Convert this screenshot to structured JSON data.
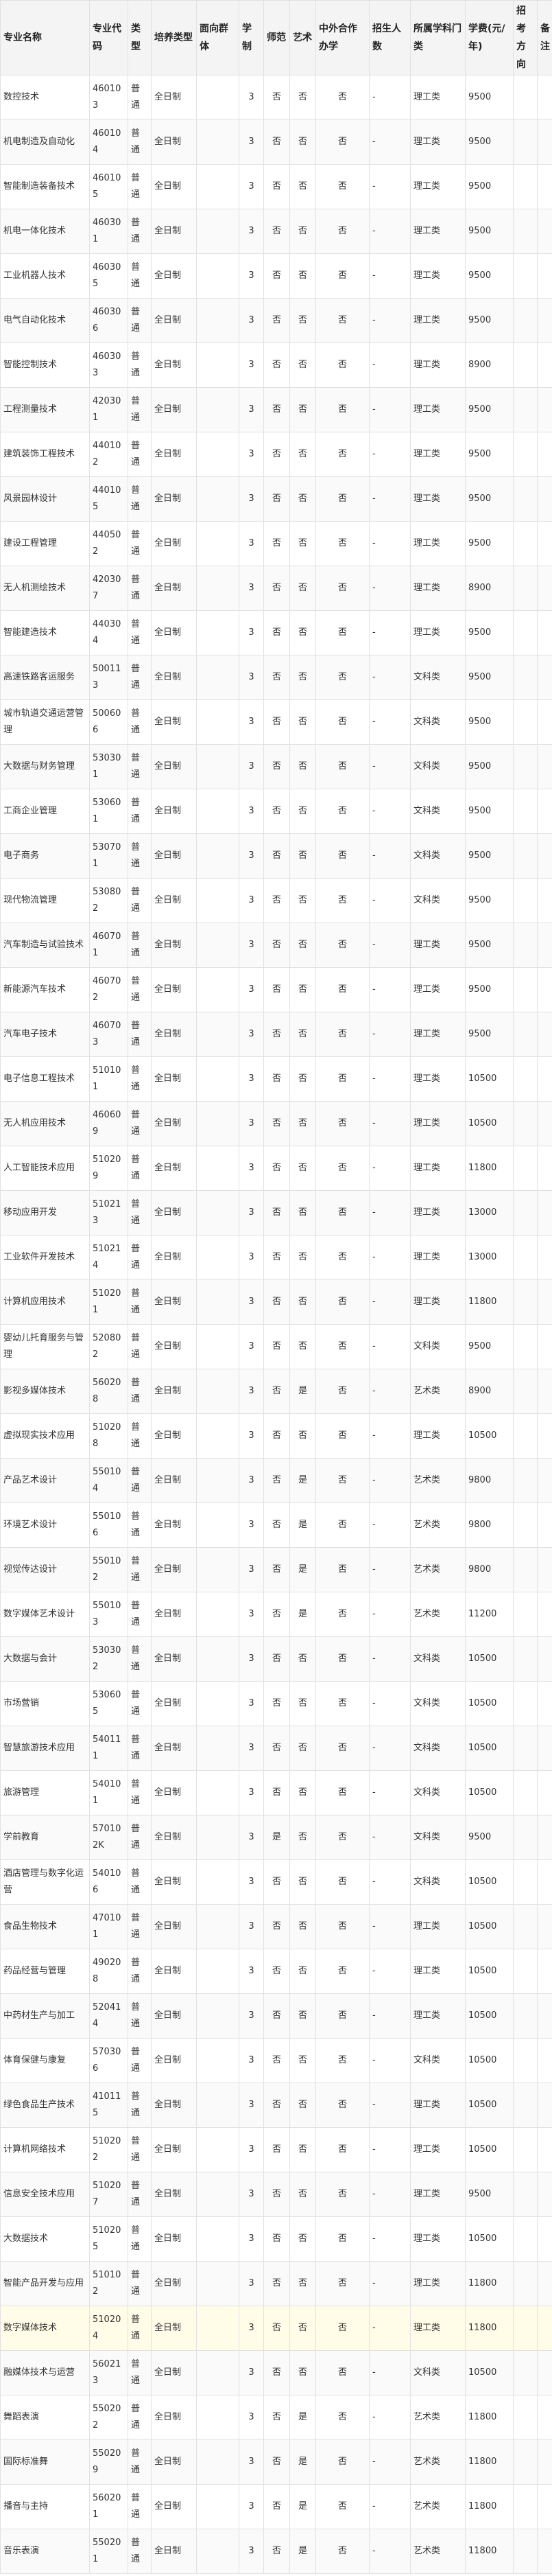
{
  "table": {
    "columns": [
      "专业名称",
      "专业代码",
      "类型",
      "培养类型",
      "面向群体",
      "学制",
      "师范",
      "艺术",
      "中外合作办学",
      "招生人数",
      "所属学科门类",
      "学费(元/年)",
      "招考方向",
      "备注"
    ],
    "rows": [
      [
        "数控技术",
        "460103",
        "普通",
        "全日制",
        "",
        "3",
        "否",
        "否",
        "否",
        "-",
        "理工类",
        "9500",
        "",
        ""
      ],
      [
        "机电制造及自动化",
        "460104",
        "普通",
        "全日制",
        "",
        "3",
        "否",
        "否",
        "否",
        "-",
        "理工类",
        "9500",
        "",
        ""
      ],
      [
        "智能制造装备技术",
        "460105",
        "普通",
        "全日制",
        "",
        "3",
        "否",
        "否",
        "否",
        "-",
        "理工类",
        "9500",
        "",
        ""
      ],
      [
        "机电一体化技术",
        "460301",
        "普通",
        "全日制",
        "",
        "3",
        "否",
        "否",
        "否",
        "-",
        "理工类",
        "9500",
        "",
        ""
      ],
      [
        "工业机器人技术",
        "460305",
        "普通",
        "全日制",
        "",
        "3",
        "否",
        "否",
        "否",
        "-",
        "理工类",
        "9500",
        "",
        ""
      ],
      [
        "电气自动化技术",
        "460306",
        "普通",
        "全日制",
        "",
        "3",
        "否",
        "否",
        "否",
        "-",
        "理工类",
        "9500",
        "",
        ""
      ],
      [
        "智能控制技术",
        "460303",
        "普通",
        "全日制",
        "",
        "3",
        "否",
        "否",
        "否",
        "-",
        "理工类",
        "8900",
        "",
        ""
      ],
      [
        "工程测量技术",
        "420301",
        "普通",
        "全日制",
        "",
        "3",
        "否",
        "否",
        "否",
        "-",
        "理工类",
        "9500",
        "",
        ""
      ],
      [
        "建筑装饰工程技术",
        "440102",
        "普通",
        "全日制",
        "",
        "3",
        "否",
        "否",
        "否",
        "-",
        "理工类",
        "9500",
        "",
        ""
      ],
      [
        "风景园林设计",
        "440105",
        "普通",
        "全日制",
        "",
        "3",
        "否",
        "否",
        "否",
        "-",
        "理工类",
        "9500",
        "",
        ""
      ],
      [
        "建设工程管理",
        "440502",
        "普通",
        "全日制",
        "",
        "3",
        "否",
        "否",
        "否",
        "-",
        "理工类",
        "9500",
        "",
        ""
      ],
      [
        "无人机测绘技术",
        "420307",
        "普通",
        "全日制",
        "",
        "3",
        "否",
        "否",
        "否",
        "-",
        "理工类",
        "8900",
        "",
        ""
      ],
      [
        "智能建造技术",
        "440304",
        "普通",
        "全日制",
        "",
        "3",
        "否",
        "否",
        "否",
        "-",
        "理工类",
        "9500",
        "",
        ""
      ],
      [
        "高速铁路客运服务",
        "500113",
        "普通",
        "全日制",
        "",
        "3",
        "否",
        "否",
        "否",
        "-",
        "文科类",
        "9500",
        "",
        ""
      ],
      [
        "城市轨道交通运营管理",
        "500606",
        "普通",
        "全日制",
        "",
        "3",
        "否",
        "否",
        "否",
        "-",
        "文科类",
        "9500",
        "",
        ""
      ],
      [
        "大数据与财务管理",
        "530301",
        "普通",
        "全日制",
        "",
        "3",
        "否",
        "否",
        "否",
        "-",
        "文科类",
        "9500",
        "",
        ""
      ],
      [
        "工商企业管理",
        "530601",
        "普通",
        "全日制",
        "",
        "3",
        "否",
        "否",
        "否",
        "-",
        "文科类",
        "9500",
        "",
        ""
      ],
      [
        "电子商务",
        "530701",
        "普通",
        "全日制",
        "",
        "3",
        "否",
        "否",
        "否",
        "-",
        "文科类",
        "9500",
        "",
        ""
      ],
      [
        "现代物流管理",
        "530802",
        "普通",
        "全日制",
        "",
        "3",
        "否",
        "否",
        "否",
        "-",
        "文科类",
        "9500",
        "",
        ""
      ],
      [
        "汽车制造与试验技术",
        "460701",
        "普通",
        "全日制",
        "",
        "3",
        "否",
        "否",
        "否",
        "-",
        "理工类",
        "9500",
        "",
        ""
      ],
      [
        "新能源汽车技术",
        "460702",
        "普通",
        "全日制",
        "",
        "3",
        "否",
        "否",
        "否",
        "-",
        "理工类",
        "9500",
        "",
        ""
      ],
      [
        "汽车电子技术",
        "460703",
        "普通",
        "全日制",
        "",
        "3",
        "否",
        "否",
        "否",
        "-",
        "理工类",
        "9500",
        "",
        ""
      ],
      [
        "电子信息工程技术",
        "510101",
        "普通",
        "全日制",
        "",
        "3",
        "否",
        "否",
        "否",
        "-",
        "理工类",
        "10500",
        "",
        ""
      ],
      [
        "无人机应用技术",
        "460609",
        "普通",
        "全日制",
        "",
        "3",
        "否",
        "否",
        "否",
        "-",
        "理工类",
        "10500",
        "",
        ""
      ],
      [
        "人工智能技术应用",
        "510209",
        "普通",
        "全日制",
        "",
        "3",
        "否",
        "否",
        "否",
        "-",
        "理工类",
        "11800",
        "",
        ""
      ],
      [
        "移动应用开发",
        "510213",
        "普通",
        "全日制",
        "",
        "3",
        "否",
        "否",
        "否",
        "-",
        "理工类",
        "13000",
        "",
        ""
      ],
      [
        "工业软件开发技术",
        "510214",
        "普通",
        "全日制",
        "",
        "3",
        "否",
        "否",
        "否",
        "-",
        "理工类",
        "13000",
        "",
        ""
      ],
      [
        "计算机应用技术",
        "510201",
        "普通",
        "全日制",
        "",
        "3",
        "否",
        "否",
        "否",
        "-",
        "理工类",
        "11800",
        "",
        ""
      ],
      [
        "婴幼儿托育服务与管理",
        "520802",
        "普通",
        "全日制",
        "",
        "3",
        "否",
        "否",
        "否",
        "-",
        "文科类",
        "9500",
        "",
        ""
      ],
      [
        "影视多媒体技术",
        "560208",
        "普通",
        "全日制",
        "",
        "3",
        "否",
        "是",
        "否",
        "-",
        "艺术类",
        "8900",
        "",
        ""
      ],
      [
        "虚拟现实技术应用",
        "510208",
        "普通",
        "全日制",
        "",
        "3",
        "否",
        "否",
        "否",
        "-",
        "理工类",
        "10500",
        "",
        ""
      ],
      [
        "产品艺术设计",
        "550104",
        "普通",
        "全日制",
        "",
        "3",
        "否",
        "是",
        "否",
        "-",
        "艺术类",
        "9800",
        "",
        ""
      ],
      [
        "环境艺术设计",
        "550106",
        "普通",
        "全日制",
        "",
        "3",
        "否",
        "是",
        "否",
        "-",
        "艺术类",
        "9800",
        "",
        ""
      ],
      [
        "视觉传达设计",
        "550102",
        "普通",
        "全日制",
        "",
        "3",
        "否",
        "是",
        "否",
        "-",
        "艺术类",
        "9800",
        "",
        ""
      ],
      [
        "数字媒体艺术设计",
        "550103",
        "普通",
        "全日制",
        "",
        "3",
        "否",
        "是",
        "否",
        "-",
        "艺术类",
        "11200",
        "",
        ""
      ],
      [
        "大数据与会计",
        "530302",
        "普通",
        "全日制",
        "",
        "3",
        "否",
        "否",
        "否",
        "-",
        "文科类",
        "10500",
        "",
        ""
      ],
      [
        "市场营销",
        "530605",
        "普通",
        "全日制",
        "",
        "3",
        "否",
        "否",
        "否",
        "-",
        "文科类",
        "10500",
        "",
        ""
      ],
      [
        "智慧旅游技术应用",
        "540111",
        "普通",
        "全日制",
        "",
        "3",
        "否",
        "否",
        "否",
        "-",
        "文科类",
        "10500",
        "",
        ""
      ],
      [
        "旅游管理",
        "540101",
        "普通",
        "全日制",
        "",
        "3",
        "否",
        "否",
        "否",
        "-",
        "文科类",
        "10500",
        "",
        ""
      ],
      [
        "学前教育",
        "570102K",
        "普通",
        "全日制",
        "",
        "3",
        "是",
        "否",
        "否",
        "-",
        "文科类",
        "9500",
        "",
        ""
      ],
      [
        "酒店管理与数字化运营",
        "540106",
        "普通",
        "全日制",
        "",
        "3",
        "否",
        "否",
        "否",
        "-",
        "文科类",
        "10500",
        "",
        ""
      ],
      [
        "食品生物技术",
        "470101",
        "普通",
        "全日制",
        "",
        "3",
        "否",
        "否",
        "否",
        "-",
        "理工类",
        "10500",
        "",
        ""
      ],
      [
        "药品经营与管理",
        "490208",
        "普通",
        "全日制",
        "",
        "3",
        "否",
        "否",
        "否",
        "-",
        "理工类",
        "10500",
        "",
        ""
      ],
      [
        "中药材生产与加工",
        "520414",
        "普通",
        "全日制",
        "",
        "3",
        "否",
        "否",
        "否",
        "-",
        "理工类",
        "10500",
        "",
        ""
      ],
      [
        "体育保健与康复",
        "570306",
        "普通",
        "全日制",
        "",
        "3",
        "否",
        "否",
        "否",
        "-",
        "文科类",
        "10500",
        "",
        ""
      ],
      [
        "绿色食品生产技术",
        "410115",
        "普通",
        "全日制",
        "",
        "3",
        "否",
        "否",
        "否",
        "-",
        "理工类",
        "10500",
        "",
        ""
      ],
      [
        "计算机网络技术",
        "510202",
        "普通",
        "全日制",
        "",
        "3",
        "否",
        "否",
        "否",
        "-",
        "理工类",
        "10500",
        "",
        ""
      ],
      [
        "信息安全技术应用",
        "510207",
        "普通",
        "全日制",
        "",
        "3",
        "否",
        "否",
        "否",
        "-",
        "理工类",
        "9500",
        "",
        ""
      ],
      [
        "大数据技术",
        "510205",
        "普通",
        "全日制",
        "",
        "3",
        "否",
        "否",
        "否",
        "-",
        "理工类",
        "10500",
        "",
        ""
      ],
      [
        "智能产品开发与应用",
        "510102",
        "普通",
        "全日制",
        "",
        "3",
        "否",
        "否",
        "否",
        "-",
        "理工类",
        "11800",
        "",
        ""
      ],
      [
        "数字媒体技术",
        "510204",
        "普通",
        "全日制",
        "",
        "3",
        "否",
        "否",
        "否",
        "-",
        "理工类",
        "11800",
        "",
        ""
      ],
      [
        "融媒体技术与运营",
        "560213",
        "普通",
        "全日制",
        "",
        "3",
        "否",
        "否",
        "否",
        "-",
        "文科类",
        "10500",
        "",
        ""
      ],
      [
        "舞蹈表演",
        "550202",
        "普通",
        "全日制",
        "",
        "3",
        "否",
        "是",
        "否",
        "-",
        "艺术类",
        "11800",
        "",
        ""
      ],
      [
        "国际标准舞",
        "550209",
        "普通",
        "全日制",
        "",
        "3",
        "否",
        "是",
        "否",
        "-",
        "艺术类",
        "11800",
        "",
        ""
      ],
      [
        "播音与主持",
        "560201",
        "普通",
        "全日制",
        "",
        "3",
        "否",
        "是",
        "否",
        "-",
        "艺术类",
        "11800",
        "",
        ""
      ],
      [
        "音乐表演",
        "550201",
        "普通",
        "全日制",
        "",
        "3",
        "否",
        "是",
        "否",
        "-",
        "艺术类",
        "11800",
        "",
        ""
      ]
    ]
  }
}
